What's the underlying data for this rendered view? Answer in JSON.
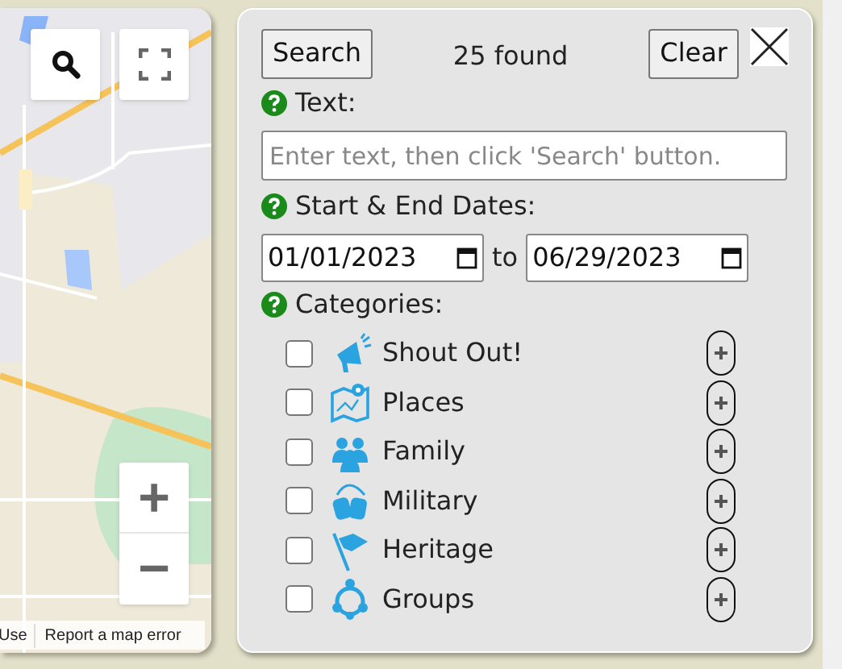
{
  "map": {
    "attribution": [
      "Use",
      "Report a map error"
    ],
    "zoom_in": "+",
    "zoom_out": "−"
  },
  "search_panel": {
    "search_button": "Search",
    "result_count": "25 found",
    "clear_button": "Clear",
    "text_label": "Text:",
    "text_field": {
      "placeholder": "Enter text, then click 'Search' button."
    },
    "dates_label": "Start & End Dates:",
    "start_date": "01/01/2023",
    "date_separator": "to",
    "end_date": "06/29/2023",
    "categories_label": "Categories:",
    "categories": [
      {
        "label": "Shout Out!",
        "checked": false
      },
      {
        "label": "Places",
        "checked": false
      },
      {
        "label": "Family",
        "checked": false
      },
      {
        "label": "Military",
        "checked": false
      },
      {
        "label": "Heritage",
        "checked": false
      },
      {
        "label": "Groups",
        "checked": false
      }
    ]
  }
}
